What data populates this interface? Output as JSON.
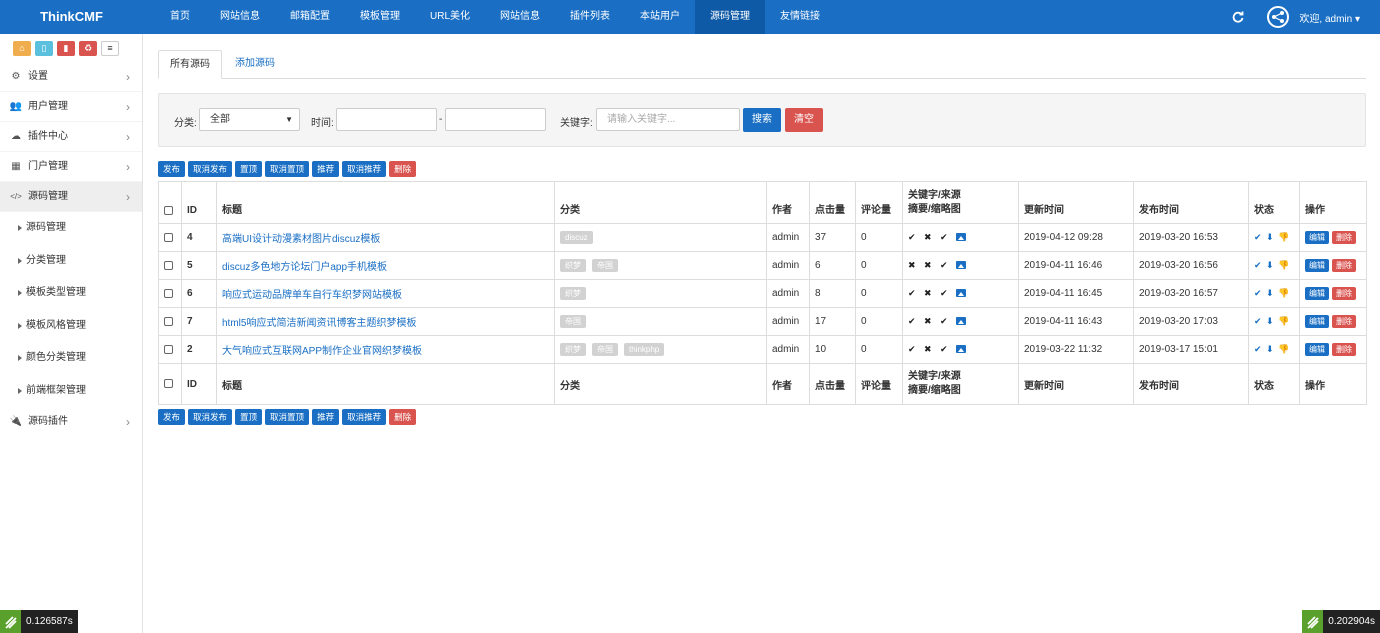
{
  "brand": "ThinkCMF",
  "nav": [
    "首页",
    "网站信息",
    "邮箱配置",
    "模板管理",
    "URL美化",
    "网站信息",
    "插件列表",
    "本站用户",
    "源码管理",
    "友情链接"
  ],
  "nav_active_index": 8,
  "header": {
    "welcome": "欢迎, admin ▾",
    "refresh_icon": "refresh-icon",
    "avatar_icon": "share-icon"
  },
  "shortcut_colors": [
    "#f0ad4e",
    "#5bc0de",
    "#d9534f",
    "#d9534f",
    "#ffffff"
  ],
  "sidebar": {
    "items": [
      {
        "label": "设置",
        "icon": "cogs-icon",
        "glyph": "⚙"
      },
      {
        "label": "用户管理",
        "icon": "users-icon",
        "glyph": "👥"
      },
      {
        "label": "插件中心",
        "icon": "cloud-icon",
        "glyph": "☁"
      },
      {
        "label": "门户管理",
        "icon": "grid-icon",
        "glyph": "▦"
      },
      {
        "label": "源码管理",
        "icon": "code-icon",
        "glyph": "</>"
      }
    ],
    "sub_items": [
      "源码管理",
      "分类管理",
      "模板类型管理",
      "模板风格管理",
      "颜色分类管理",
      "前端框架管理"
    ],
    "last_item": {
      "label": "源码插件",
      "icon": "plug-icon",
      "glyph": "🔌"
    }
  },
  "tabs": [
    "所有源码",
    "添加源码"
  ],
  "filter": {
    "category_label": "分类:",
    "category_value": "全部",
    "time_label": "时间:",
    "time_sep": "-",
    "keyword_label": "关键字:",
    "keyword_placeholder": "请输入关键字...",
    "search_button": "搜索",
    "clear_button": "清空"
  },
  "actions": [
    "发布",
    "取消发布",
    "置顶",
    "取消置顶",
    "推荐",
    "取消推荐",
    "删除"
  ],
  "table": {
    "headers": {
      "id": "ID",
      "title": "标题",
      "category": "分类",
      "author": "作者",
      "hits": "点击量",
      "comments": "评论量",
      "kw_line1": "关键字/来源",
      "kw_line2": "摘要/缩略图",
      "updated": "更新时间",
      "published": "发布时间",
      "status": "状态",
      "ops": "操作"
    },
    "rows": [
      {
        "id": "4",
        "title": "高端UI设计动漫素材图片discuz模板",
        "tags": [
          "discuz"
        ],
        "author": "admin",
        "hits": "37",
        "comments": "0",
        "marks": [
          "✔",
          "✖",
          "✔"
        ],
        "updated": "2019-04-12 09:28",
        "published": "2019-03-20 16:53"
      },
      {
        "id": "5",
        "title": "discuz多色地方论坛门户app手机模板",
        "tags": [
          "织梦",
          "帝国"
        ],
        "author": "admin",
        "hits": "6",
        "comments": "0",
        "marks": [
          "✖",
          "✖",
          "✔"
        ],
        "updated": "2019-04-11 16:46",
        "published": "2019-03-20 16:56"
      },
      {
        "id": "6",
        "title": "响应式运动品牌单车自行车织梦网站模板",
        "tags": [
          "织梦"
        ],
        "author": "admin",
        "hits": "8",
        "comments": "0",
        "marks": [
          "✔",
          "✖",
          "✔"
        ],
        "updated": "2019-04-11 16:45",
        "published": "2019-03-20 16:57"
      },
      {
        "id": "7",
        "title": "html5响应式简洁新闻资讯博客主题织梦模板",
        "tags": [
          "帝国"
        ],
        "author": "admin",
        "hits": "17",
        "comments": "0",
        "marks": [
          "✔",
          "✖",
          "✔"
        ],
        "updated": "2019-04-11 16:43",
        "published": "2019-03-20 17:03"
      },
      {
        "id": "2",
        "title": "大气响应式互联网APP制作企业官网织梦模板",
        "tags": [
          "织梦",
          "帝国",
          "thinkphp"
        ],
        "author": "admin",
        "hits": "10",
        "comments": "0",
        "marks": [
          "✔",
          "✖",
          "✔"
        ],
        "updated": "2019-03-22 11:32",
        "published": "2019-03-17 15:01"
      }
    ],
    "status_glyphs": [
      "✔",
      "⬇",
      "👎"
    ],
    "edit_label": "编辑",
    "delete_label": "删除"
  },
  "timers": {
    "left": "0.126587s",
    "right": "0.202904s"
  }
}
